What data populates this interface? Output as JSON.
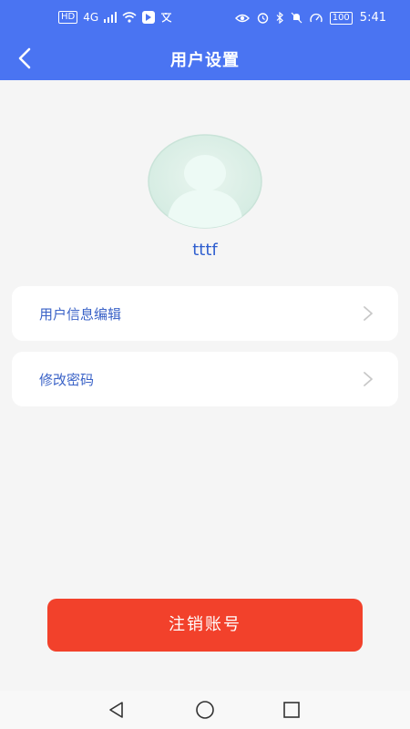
{
  "status_bar": {
    "left_icons": [
      "hd-icon",
      "4g-signal-icon",
      "wifi-icon",
      "app-notification-icon",
      "translate-icon"
    ],
    "hd_label": "HD",
    "network_label": "4G",
    "right_icons": [
      "eye-icon",
      "alarm-icon",
      "bluetooth-icon",
      "mute-icon",
      "speed-icon",
      "battery-icon"
    ],
    "battery": "100",
    "time": "5:41"
  },
  "header": {
    "title": "用户设置",
    "back_icon": "chevron-left-icon",
    "color": "#4a74f2"
  },
  "profile": {
    "avatar_icon": "default-avatar-icon",
    "username": "tttf"
  },
  "menu": {
    "items": [
      {
        "label": "用户信息编辑",
        "icon": "chevron-right-icon"
      },
      {
        "label": "修改密码",
        "icon": "chevron-right-icon"
      }
    ]
  },
  "logout": {
    "label": "注销账号",
    "color": "#f2412b"
  },
  "system_nav": {
    "icons": [
      "back-triangle-icon",
      "home-circle-icon",
      "recents-square-icon"
    ]
  }
}
